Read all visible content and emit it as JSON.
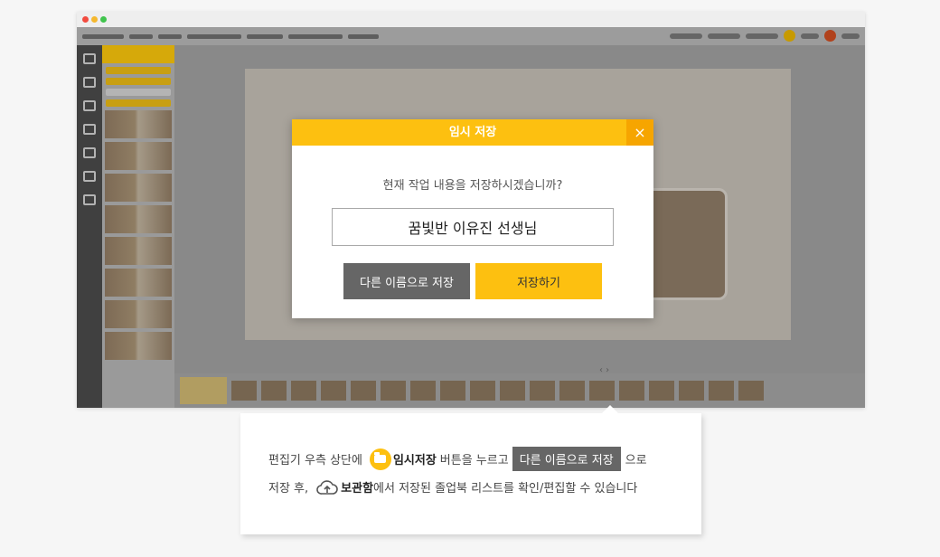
{
  "modal": {
    "title": "임시 저장",
    "close_icon": "×",
    "question": "현재 작업 내용을 저장하시겠습니까?",
    "input_value": "꿈빛반 이유진 선생님",
    "save_as_label": "다른 이름으로 저장",
    "save_label": "저장하기"
  },
  "info": {
    "line1_pre": "편집기 우측 상단에",
    "line1_bold": "임시저장",
    "line1_mid": "버튼을 누르고",
    "line1_chip": "다른 이름으로 저장",
    "line1_post": "으로",
    "line2_pre": "저장 후,",
    "line2_bold": "보관함",
    "line2_post": "에서 저장된 졸업북 리스트를 확인/편집할 수 있습니다"
  },
  "colors": {
    "accent": "#fdc010",
    "close_bg": "#f6a500",
    "chip_bg": "#666666"
  },
  "icons": {
    "folder": "folder-icon",
    "cloud_upload": "cloud-upload-icon"
  }
}
